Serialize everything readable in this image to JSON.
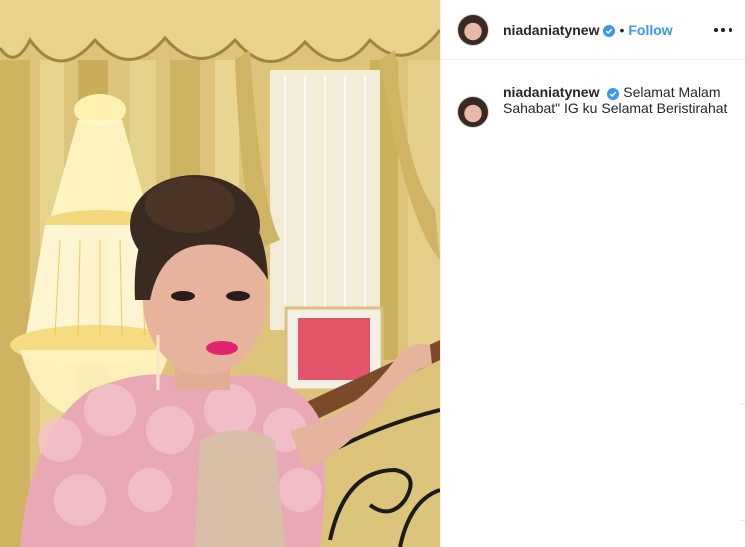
{
  "post": {
    "author": {
      "username": "niadaniatynew",
      "verified": true,
      "avatar_icon": "profile-photo-icon"
    },
    "header": {
      "separator": "•",
      "follow_label": "Follow",
      "more_icon": "more-options-icon"
    },
    "caption": {
      "username": "niadaniatynew",
      "text": "Selamat Malam Sahabat\" IG ku Selamat Beristirahat"
    },
    "photo": {
      "description_icon": "post-photo",
      "colors": {
        "curtain": "#e3cf86",
        "curtain_dark": "#b89a4a",
        "chandelier": "#fff6c8",
        "dress": "#e9a9b4",
        "hair": "#3b2a20",
        "skin": "#e6b49c",
        "lips": "#e0246f"
      }
    },
    "colors": {
      "accent": "#3897f0",
      "text": "#262626",
      "border": "#efefef"
    }
  }
}
